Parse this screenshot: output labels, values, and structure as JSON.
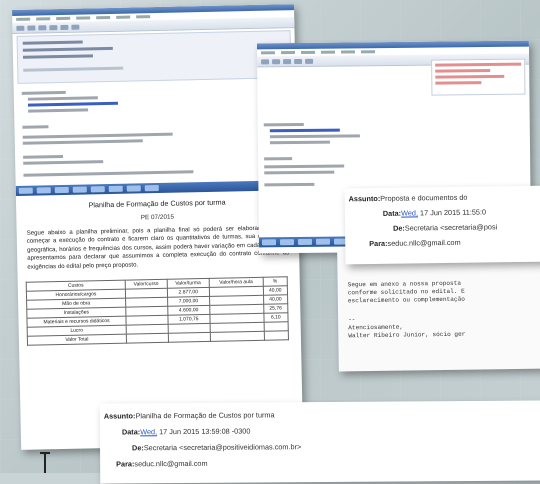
{
  "doc_a": {
    "title": "Planilha de Formação de Custos por turma",
    "subtitle": "PE 07/2015",
    "paragraph": "Segue abaixo a planilha preliminar, pois a planilha final só poderá ser elaborada quando começar a execução do contrato e ficarem claro os quantitativos de turmas, sua distribuição geográfica, horários e frequências dos cursos, assim poderá haver variação em cada item. Mas apresentamos para declarar que assumimos a completa execução do contrato conforme as exigências do edital pelo preço proposto.",
    "table": {
      "headers": [
        "Custos",
        "Valor/curso",
        "Valor/turma",
        "Valor/hora aula",
        "%"
      ],
      "rows": [
        [
          "Honorários/cargos",
          "",
          "2.877,00",
          "",
          "40,00"
        ],
        [
          "Mão de obra",
          "",
          "7.000,00",
          "",
          "40,00"
        ],
        [
          "Instalações",
          "",
          "4.600,00",
          "",
          "25,76"
        ],
        [
          "Materiais e recursos didáticos",
          "",
          "1.070,75",
          "",
          "6,10"
        ],
        [
          "Lucro",
          "",
          "",
          "",
          ""
        ],
        [
          "Valor Total",
          "",
          "",
          "",
          ""
        ]
      ]
    }
  },
  "card_right": {
    "subject_label": "Assunto:",
    "subject": "Proposta e documentos do",
    "date_label": "Data:",
    "date_day": "Wed,",
    "date_rest": "17 Jun 2015 11:55:0",
    "from_label": "De:",
    "from": "Secretaria <secretaria@posi",
    "to_label": "Para:",
    "to": "seduc.nllc@gmail.com"
  },
  "note_right": {
    "body": "Segue em anexo a nossa proposta \nconforme solicitado no edital. E\nesclarecimento ou complementação",
    "sig_sep": "--",
    "sig_1": "Atenciosamente,",
    "sig_2": "Walter Ribeiro Junior, sócio ger"
  },
  "card_bottom": {
    "subject_label": "Assunto:",
    "subject": "Planilha de Formação de Custos por turma",
    "date_label": "Data:",
    "date_day": "Wed,",
    "date_rest": "17 Jun 2015 13:59:08 -0300",
    "from_label": "De:",
    "from": "Secretaria <secretaria@positiveidiomas.com.br>",
    "to_label": "Para:",
    "to": "seduc.nllc@gmail.com"
  }
}
